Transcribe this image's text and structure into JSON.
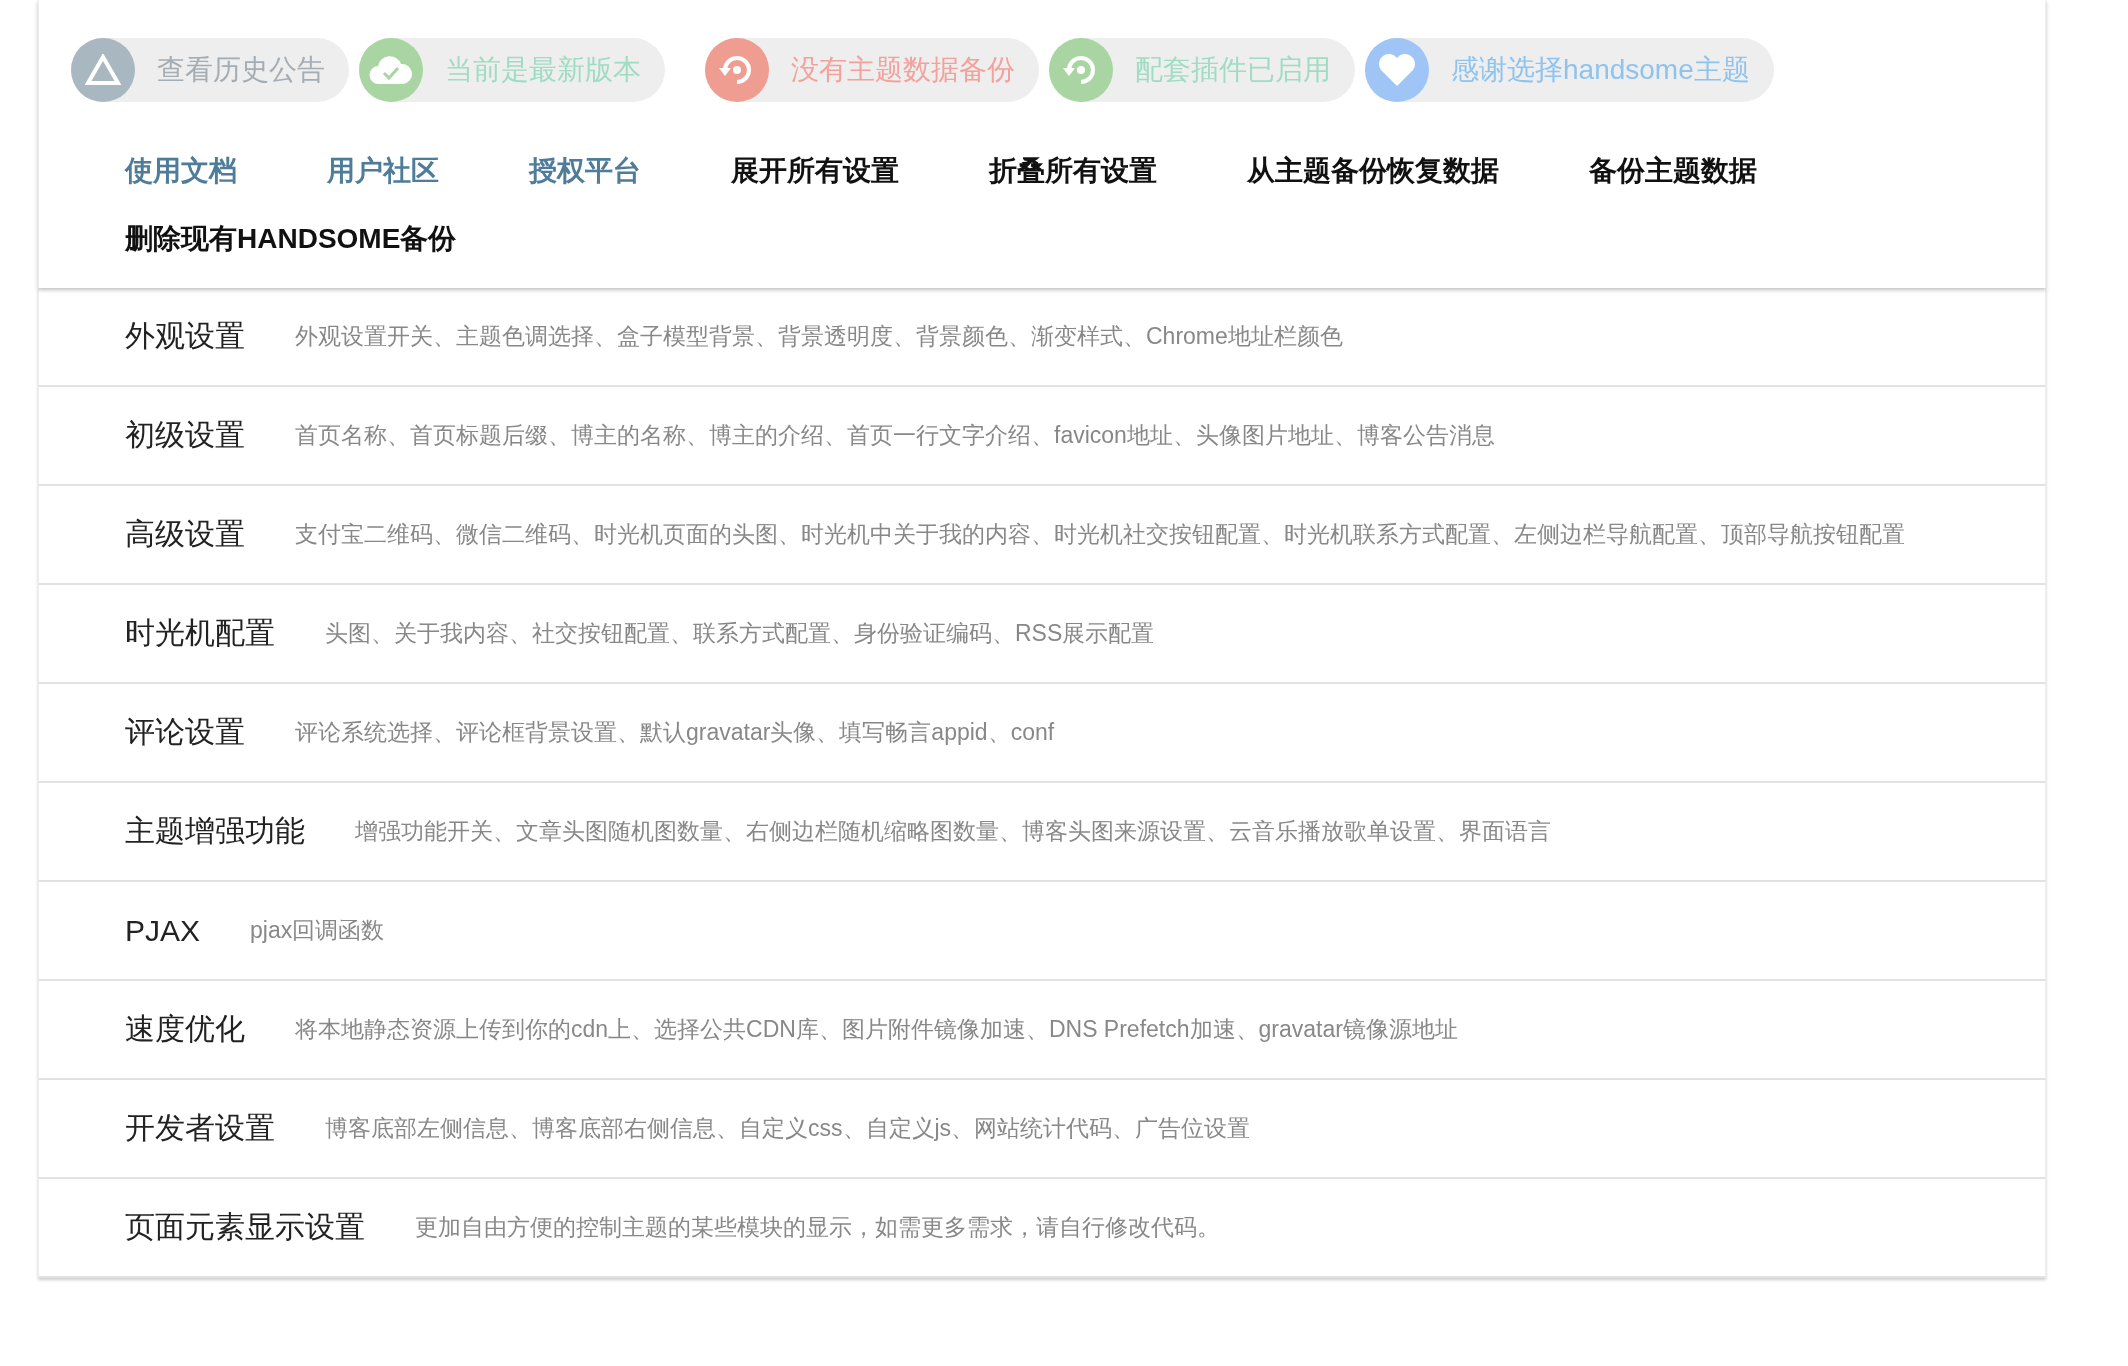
{
  "badges": [
    {
      "kind": "notice",
      "label": "查看历史公告",
      "color": "#a9b7c1"
    },
    {
      "kind": "version",
      "label": "当前是最新版本",
      "color": "#a8d5a2"
    },
    {
      "kind": "backup",
      "label": "没有主题数据备份",
      "color": "#ef9d91"
    },
    {
      "kind": "plugin",
      "label": "配套插件已启用",
      "color": "#a8d5a2"
    },
    {
      "kind": "thanks",
      "label": "感谢选择handsome主题",
      "color": "#9ec5f5"
    }
  ],
  "nav": [
    {
      "kind": "link",
      "label": "使用文档"
    },
    {
      "kind": "link",
      "label": "用户社区"
    },
    {
      "kind": "link",
      "label": "授权平台"
    },
    {
      "kind": "action",
      "label": "展开所有设置"
    },
    {
      "kind": "action",
      "label": "折叠所有设置"
    },
    {
      "kind": "action",
      "label": "从主题备份恢复数据"
    },
    {
      "kind": "action",
      "label": "备份主题数据"
    },
    {
      "kind": "action",
      "label": "删除现有HANDSOME备份"
    }
  ],
  "sections": [
    {
      "title": "外观设置",
      "description": "外观设置开关、主题色调选择、盒子模型背景、背景透明度、背景颜色、渐变样式、Chrome地址栏颜色"
    },
    {
      "title": "初级设置",
      "description": "首页名称、首页标题后缀、博主的名称、博主的介绍、首页一行文字介绍、favicon地址、头像图片地址、博客公告消息"
    },
    {
      "title": "高级设置",
      "description": "支付宝二维码、微信二维码、时光机页面的头图、时光机中关于我的内容、时光机社交按钮配置、时光机联系方式配置、左侧边栏导航配置、顶部导航按钮配置"
    },
    {
      "title": "时光机配置",
      "description": "头图、关于我内容、社交按钮配置、联系方式配置、身份验证编码、RSS展示配置"
    },
    {
      "title": "评论设置",
      "description": "评论系统选择、评论框背景设置、默认gravatar头像、填写畅言appid、conf"
    },
    {
      "title": "主题增强功能",
      "description": "增强功能开关、文章头图随机图数量、右侧边栏随机缩略图数量、博客头图来源设置、云音乐播放歌单设置、界面语言"
    },
    {
      "title": "PJAX",
      "description": "pjax回调函数"
    },
    {
      "title": "速度优化",
      "description": "将本地静态资源上传到你的cdn上、选择公共CDN库、图片附件镜像加速、DNS Prefetch加速、gravatar镜像源地址"
    },
    {
      "title": "开发者设置",
      "description": "博客底部左侧信息、博客底部右侧信息、自定义css、自定义js、网站统计代码、广告位设置"
    },
    {
      "title": "页面元素显示设置",
      "description": "更加自由方便的控制主题的某些模块的显示，如需更多需求，请自行修改代码。"
    }
  ]
}
